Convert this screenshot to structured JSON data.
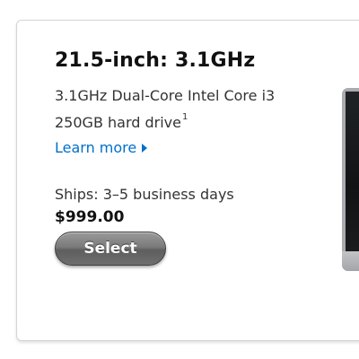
{
  "product": {
    "title": "21.5-inch: 3.1GHz",
    "processor": "3.1GHz Dual-Core Intel Core i3",
    "storage": "250GB hard drive",
    "storage_footnote": "1",
    "learn_more_label": "Learn more",
    "learn_more_icon": "chevron-right-icon",
    "shipping": "Ships: 3–5 business days",
    "price": "$999.00",
    "select_label": "Select"
  },
  "colors": {
    "link": "#0070c9",
    "button": "#6e6e6e",
    "text": "#333333"
  }
}
